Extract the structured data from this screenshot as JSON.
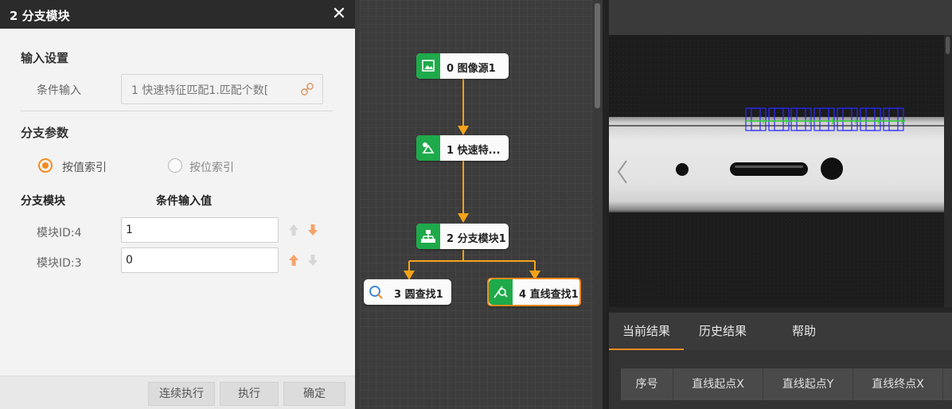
{
  "dialog": {
    "title": "2 分支模块",
    "close_glyph": "✕",
    "input_section": {
      "heading": "输入设置",
      "condition_label": "条件输入",
      "condition_value": "1 快速特征匹配1.匹配个数[",
      "link_icon": "link-icon"
    },
    "branch_section": {
      "heading": "分支参数",
      "radio_options": [
        {
          "label": "按值索引",
          "selected": true
        },
        {
          "label": "按位索引",
          "selected": false
        }
      ],
      "col_module": "分支模块",
      "col_value": "条件输入值",
      "rows": [
        {
          "label": "模块ID:4",
          "value": "1"
        },
        {
          "label": "模块ID:3",
          "value": "0"
        }
      ]
    },
    "footer": {
      "btn_continuous": "连续执行",
      "btn_run": "执行",
      "btn_ok": "确定"
    }
  },
  "flow": {
    "nodes": [
      {
        "label": "0 图像源1",
        "icon": "image-icon"
      },
      {
        "label": "1 快速特...",
        "icon": "feature-match-icon"
      },
      {
        "label": "2 分支模块1",
        "icon": "branch-icon"
      },
      {
        "label": "3 圆查找1",
        "icon": "circle-find-icon"
      },
      {
        "label": "4 直线查找1",
        "icon": "line-find-icon"
      }
    ],
    "connector_color": "#f5a31a",
    "node_icon_color": "#1eaa4a"
  },
  "result_panel": {
    "tabs": [
      "当前结果",
      "历史结果",
      "帮助"
    ],
    "columns": [
      "序号",
      "直线起点X",
      "直线起点Y",
      "直线终点X"
    ],
    "accent": "#f28b20"
  }
}
